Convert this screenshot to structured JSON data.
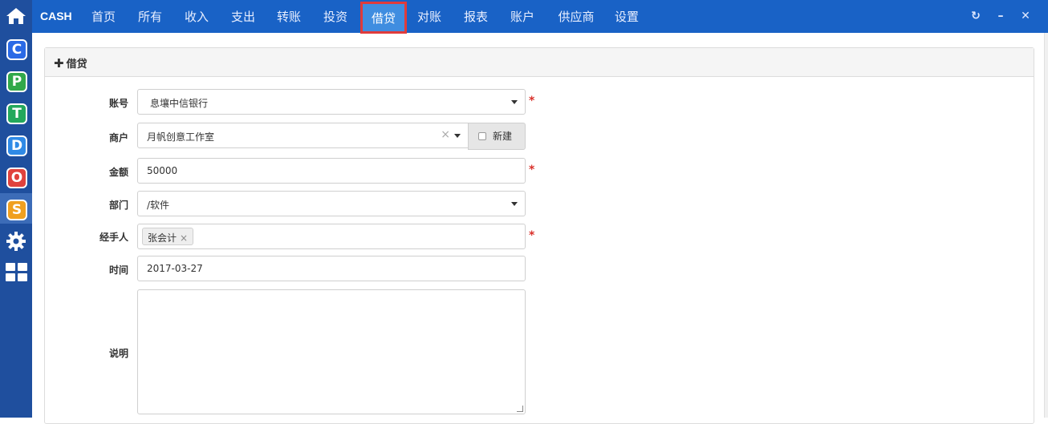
{
  "rail": {
    "home_icon": "home-icon",
    "apps": [
      {
        "name": "C",
        "color": "#2a6ae6"
      },
      {
        "name": "P",
        "color": "#31a84a"
      },
      {
        "name": "T",
        "color": "#23a85c"
      },
      {
        "name": "D",
        "color": "#2f8ae6"
      },
      {
        "name": "O",
        "color": "#e0423d"
      },
      {
        "name": "S",
        "color": "#f0a020"
      }
    ],
    "settings_icon": "gear-icon",
    "grid_icon": "grid-icon"
  },
  "topbar": {
    "brand": "CASH",
    "nav": [
      "首页",
      "所有",
      "收入",
      "支出",
      "转账",
      "投资",
      "借贷",
      "对账",
      "报表",
      "账户",
      "供应商",
      "设置"
    ],
    "active_nav": "借贷",
    "controls": {
      "refresh": "↻",
      "minimize": "–",
      "close": "✕"
    }
  },
  "panel": {
    "title": "借贷",
    "form": {
      "account_label": "账号",
      "account_value": "息壤中信银行",
      "merchant_label": "商户",
      "merchant_value": "月帆创意工作室",
      "new_label": "新建",
      "amount_label": "金额",
      "amount_value": "50000",
      "dept_label": "部门",
      "dept_value": "/软件",
      "handler_label": "经手人",
      "handler_tag": "张会计",
      "time_label": "时间",
      "time_value": "2017-03-27",
      "desc_label": "说明",
      "desc_value": ""
    },
    "required_mark": "*"
  },
  "colors": {
    "topbar": "#1962c6",
    "rail": "#1f4f9e",
    "active_tab_border": "#e03b3b",
    "required": "#d9312b"
  }
}
